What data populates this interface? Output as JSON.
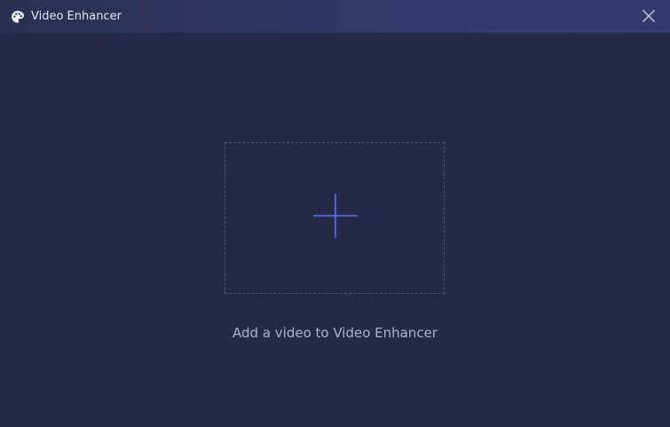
{
  "window": {
    "title": "Video Enhancer",
    "app_icon": "palette-icon",
    "close_icon": "close-icon"
  },
  "main": {
    "drop_zone_icon": "plus-icon",
    "hint": "Add a video to Video Enhancer"
  },
  "colors": {
    "background": "#252a49",
    "titlebar": "#34386a",
    "accent": "#5b6ef0",
    "text": "#e3e5f2",
    "hint_text": "#aeb1c8",
    "dashed_border": "#4a4f72"
  }
}
